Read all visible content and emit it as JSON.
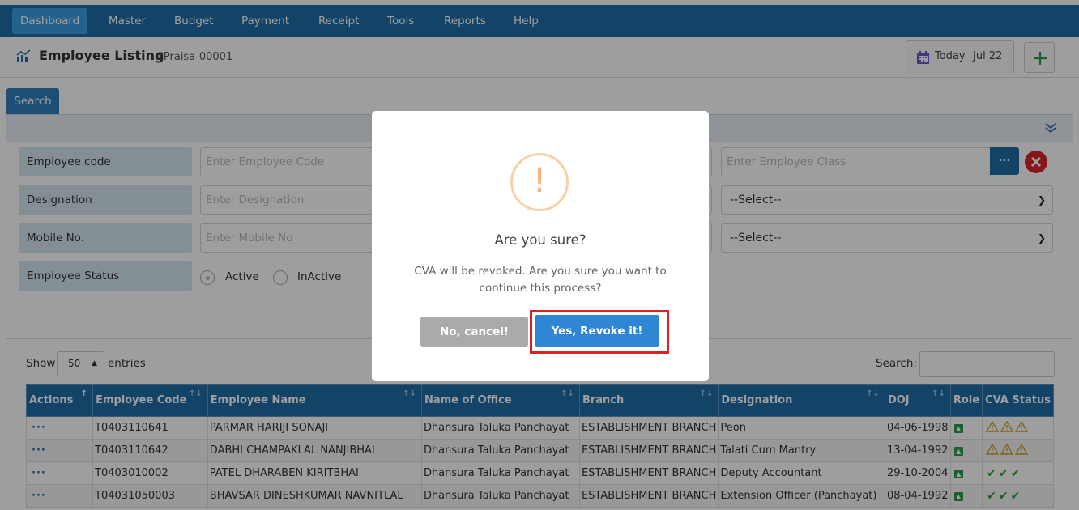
{
  "nav": {
    "items": [
      {
        "label": "Dashboard",
        "active": true
      },
      {
        "label": "Master"
      },
      {
        "label": "Budget"
      },
      {
        "label": "Payment"
      },
      {
        "label": "Receipt"
      },
      {
        "label": "Tools"
      },
      {
        "label": "Reports"
      },
      {
        "label": "Help"
      }
    ]
  },
  "header": {
    "title": "Employee Listing",
    "id": "#Praisa-00001",
    "today_label": "Today",
    "today_date": "Jul 22",
    "icons": {
      "title": "chart-icon",
      "calendar": "calendar-icon",
      "add": "plus-icon"
    }
  },
  "search": {
    "tab_label": "Search",
    "fields": {
      "employee_code": {
        "label": "Employee code",
        "placeholder": "Enter Employee Code"
      },
      "designation": {
        "label": "Designation",
        "placeholder": "Enter Designation"
      },
      "mobile": {
        "label": "Mobile No.",
        "placeholder": "Enter Mobile No"
      },
      "status": {
        "label": "Employee Status",
        "options": [
          "Active",
          "InActive"
        ],
        "selected": "Active"
      }
    },
    "employee_class_placeholder": "Enter Employee Class",
    "ellipsis_label": "...",
    "select_1": "--Select--",
    "select_2": "--Select--"
  },
  "table": {
    "show_label": "Show",
    "page_size": "50",
    "entries_label": "entries",
    "search_label": "Search:",
    "columns": [
      "Actions",
      "Employee Code",
      "Employee Name",
      "Name of Office",
      "Branch",
      "Designation",
      "DOJ",
      "Role",
      "CVA Status"
    ],
    "actions_glyph": "···",
    "rows": [
      {
        "code": "T0403110641",
        "name": "PARMAR HARIJI SONAJI",
        "office": "Dhansura Taluka Panchayat",
        "branch": "ESTABLISHMENT BRANCH",
        "designation": "Peon",
        "doj": "04-06-1998",
        "cva": "warning"
      },
      {
        "code": "T0403110642",
        "name": "DABHI CHAMPAKLAL NANJIBHAI",
        "office": "Dhansura Taluka Panchayat",
        "branch": "ESTABLISHMENT BRANCH",
        "designation": "Talati Cum Mantry",
        "doj": "13-04-1992",
        "cva": "warning"
      },
      {
        "code": "T0403010002",
        "name": "PATEL DHARABEN KIRITBHAI",
        "office": "Dhansura Taluka Panchayat",
        "branch": "ESTABLISHMENT BRANCH",
        "designation": "Deputy Accountant",
        "doj": "29-10-2004",
        "cva": "ok"
      },
      {
        "code": "T04031050003",
        "name": "BHAVSAR DINESHKUMAR NAVNITLAL",
        "office": "Dhansura Taluka Panchayat",
        "branch": "ESTABLISHMENT BRANCH",
        "designation": "Extension Officer (Panchayat)",
        "doj": "08-04-1992",
        "cva": "ok"
      }
    ]
  },
  "modal": {
    "icon": "!",
    "title": "Are you sure?",
    "text": "CVA will be revoked. Are you sure you want to continue this process?",
    "cancel_label": "No, cancel!",
    "confirm_label": "Yes, Revoke it!"
  },
  "colors": {
    "primary": "#1f6fa9",
    "active_nav": "#3a9ee4",
    "confirm": "#2e86d4",
    "cancel": "#aaaaaa",
    "highlight": "#e02020",
    "warning_icon": "#f5b67c",
    "ok": "#2a9a3a"
  }
}
